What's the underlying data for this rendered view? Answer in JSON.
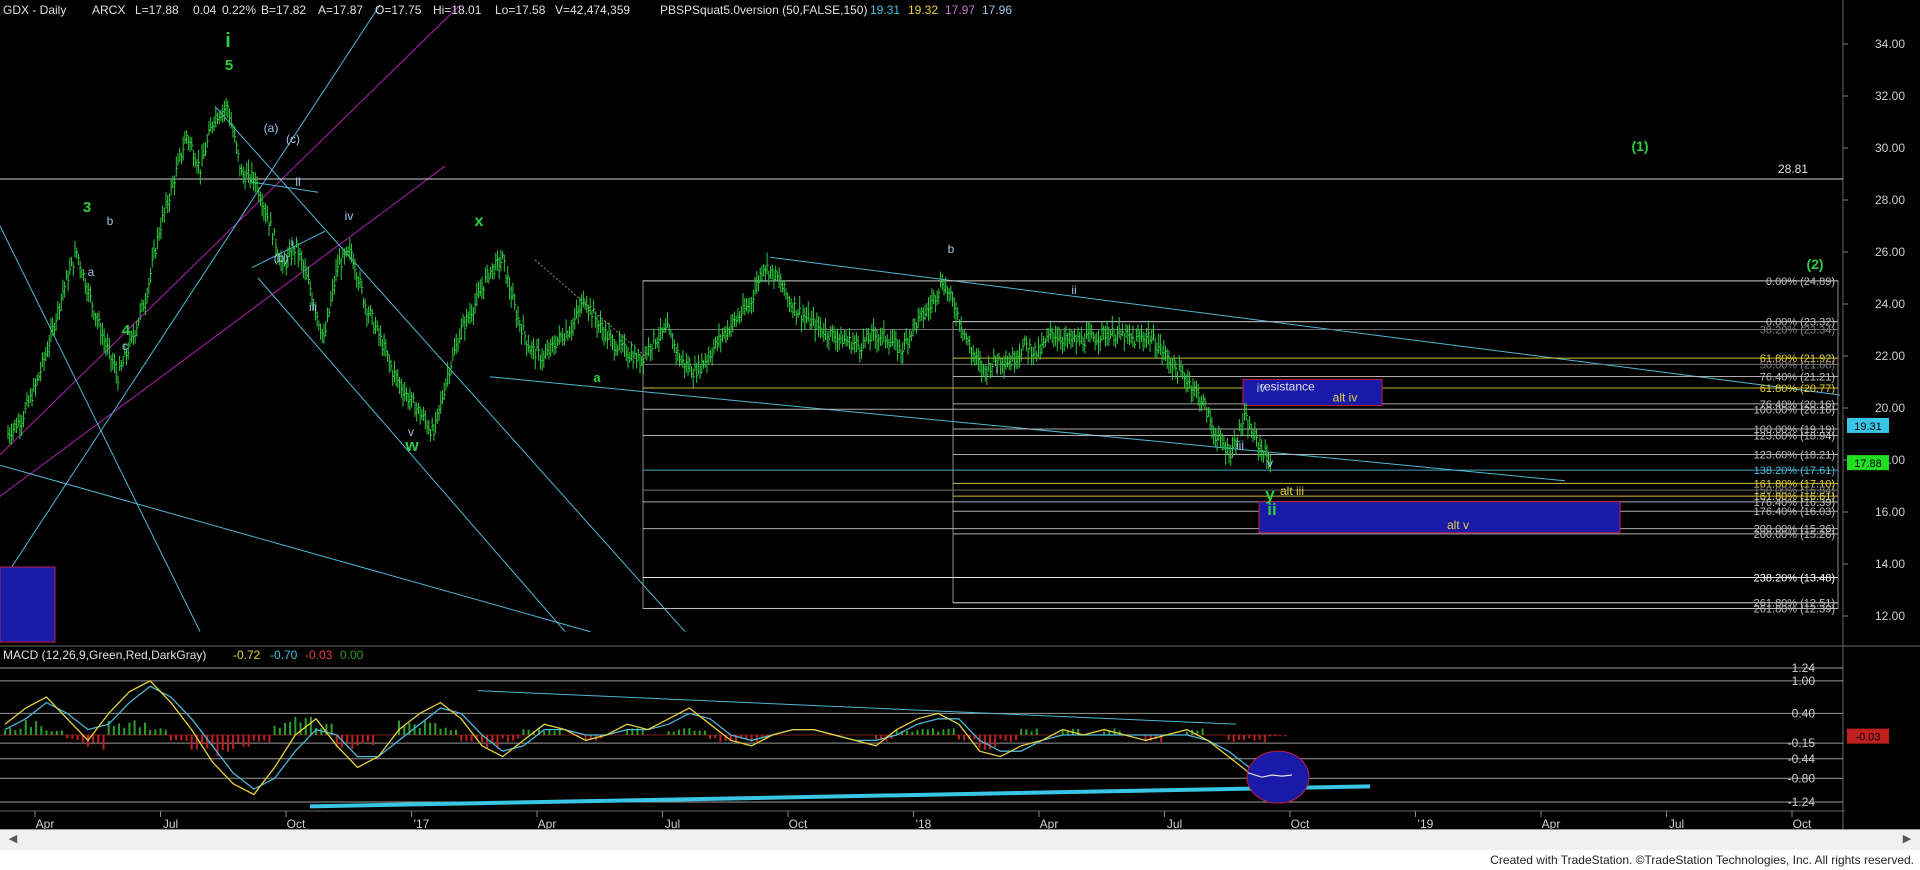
{
  "header": {
    "symbol": "GDX - Daily",
    "exchange": "ARCX",
    "last": "L=17.88",
    "change": "0.04",
    "change_pct": "0.22%",
    "bid": "B=17.82",
    "ask": "A=17.87",
    "open": "O=17.75",
    "high": "Hi=18.01",
    "low": "Lo=17.58",
    "volume": "V=42,474,359",
    "indicator": "PBSPSquat5.0version (50,FALSE,150)",
    "ind_values": [
      "19.31",
      "19.32",
      "17.97",
      "17.96"
    ]
  },
  "colors": {
    "background": "#000000",
    "wave_green": "#2ecc40",
    "wave_blue": "#a0c4e8",
    "channel_blue": "#4fb7d6",
    "channel_magenta": "#b01fb0",
    "resistance_box": "#1a1aa8",
    "fib_yellow": "#e6d23c",
    "macd_green": "#2aa02a",
    "macd_red": "#c02020",
    "price_tag_blue": "#39c5e6",
    "price_tag_green": "#22dd22"
  },
  "chart_data": [
    {
      "type": "line",
      "name": "price",
      "title": "GDX - Daily",
      "ylim": [
        11,
        35
      ],
      "yticks": [
        "34.00",
        "32.00",
        "30.00",
        "28.00",
        "26.00",
        "24.00",
        "22.00",
        "20.00",
        "18.00",
        "16.00",
        "14.00",
        "12.00"
      ],
      "x_tick_labels": [
        "Apr",
        "Jul",
        "Oct",
        "'17",
        "Apr",
        "Jul",
        "Oct",
        "'18",
        "Apr",
        "Jul",
        "Oct",
        "'19",
        "Apr",
        "Jul",
        "Oct"
      ],
      "series": [
        {
          "values": [
            19.0,
            19.6,
            20.8,
            22.5,
            24.5,
            26.0,
            24.2,
            22.6,
            21.2,
            22.6,
            24.2,
            26.8,
            28.6,
            30.5,
            29.2,
            31.2,
            31.6,
            29.0,
            28.8,
            27.2,
            25.4,
            26.2,
            24.6,
            22.6,
            25.5,
            26.0,
            24.0,
            22.8,
            21.4,
            20.5,
            19.8,
            19.0,
            21.3,
            23.0,
            24.0,
            25.2,
            25.7,
            23.6,
            22.3,
            21.9,
            22.6,
            23.1,
            24.2,
            23.2,
            22.5,
            22.2,
            21.8,
            22.6,
            23.0,
            21.8,
            21.4,
            22.0,
            22.8,
            23.4,
            24.0,
            25.5,
            25.0,
            24.0,
            23.5,
            23.1,
            22.8,
            22.6,
            22.4,
            22.8,
            22.7,
            22.2,
            23.2,
            23.8,
            24.9,
            23.8,
            22.3,
            21.4,
            21.9,
            21.8,
            22.4,
            22.1,
            22.9,
            22.6,
            22.6,
            22.7,
            22.9,
            22.8,
            22.6,
            22.8,
            22.2,
            21.5,
            21.0,
            20.2,
            18.8,
            18.3,
            19.6,
            18.6,
            17.88
          ]
        }
      ],
      "wave_labels_green": [
        "i",
        "5",
        "3",
        "4",
        "x",
        "a",
        "w",
        "y",
        "ii",
        "(1)",
        "(2)"
      ],
      "wave_labels_blue": [
        "(a)",
        "(c)",
        "(b)",
        "ii",
        "i",
        "iv",
        "iii",
        "v",
        "b",
        "ii",
        "i",
        "iv",
        "iii",
        "v",
        "a",
        "b",
        "c"
      ],
      "box_labels": {
        "resistance": "resistance",
        "alt_iv": "alt iv",
        "alt_iii": "alt iii",
        "alt_v": "alt v"
      },
      "hline_label": "28.81",
      "fib_levels": [
        {
          "label": "0.00% (24.89)",
          "price": 24.89,
          "color": "#c0c0c0"
        },
        {
          "label": "0.00% (23.32)",
          "price": 23.32,
          "color": "#c0c0c0"
        },
        {
          "label": "38.20% (23.34)",
          "price": 23.02,
          "color": "#7e7e7e"
        },
        {
          "label": "61.80% (21.92)",
          "price": 21.92,
          "color": "#e6d23c"
        },
        {
          "label": "50.00% (21.68)",
          "price": 21.68,
          "color": "#7e7e7e"
        },
        {
          "label": "76.40% (21.21)",
          "price": 21.21,
          "color": "#c0c0c0"
        },
        {
          "label": "61.80% (20.77)",
          "price": 20.77,
          "color": "#e6d23c"
        },
        {
          "label": "76.40% (20.16)",
          "price": 20.16,
          "color": "#c0c0c0"
        },
        {
          "label": "100.00% (20.16)",
          "price": 19.95,
          "color": "#c0c0c0"
        },
        {
          "label": "100.00% (19.19)",
          "price": 19.19,
          "color": "#c0c0c0"
        },
        {
          "label": "123.60% (18.94)",
          "price": 18.94,
          "color": "#c0c0c0"
        },
        {
          "label": "123.60% (18.21)",
          "price": 18.21,
          "color": "#c0c0c0"
        },
        {
          "label": "138.20% (17.61)",
          "price": 17.61,
          "color": "#4fb7d6"
        },
        {
          "label": "161.80% (17.10)",
          "price": 17.1,
          "color": "#e6d23c"
        },
        {
          "label": "150.00% (16.84)",
          "price": 16.84,
          "color": "#7e7e7e"
        },
        {
          "label": "161.80% (16.61)",
          "price": 16.61,
          "color": "#e6d23c"
        },
        {
          "label": "176.40% (16.39)",
          "price": 16.39,
          "color": "#c0c0c0"
        },
        {
          "label": "176.40% (16.03)",
          "price": 16.03,
          "color": "#c0c0c0"
        },
        {
          "label": "200.00% (15.26)",
          "price": 15.36,
          "color": "#c0c0c0"
        },
        {
          "label": "200.00% (15.26)",
          "price": 15.16,
          "color": "#c0c0c0"
        },
        {
          "label": "238.20% (13.48)",
          "price": 13.48,
          "color": "#ffffff"
        },
        {
          "label": "261.80% (12.51)",
          "price": 12.51,
          "color": "#c0c0c0"
        },
        {
          "label": "261.80% (12.39)",
          "price": 12.29,
          "color": "#c0c0c0"
        }
      ],
      "price_tags": [
        {
          "label": "19.31",
          "price": 19.31,
          "color": "#39c5e6"
        },
        {
          "label": "17.88",
          "price": 17.88,
          "color": "#22dd22"
        }
      ]
    },
    {
      "type": "line",
      "name": "MACD",
      "title": "MACD (12,26,9,Green,Red,DarkGray)",
      "params_values": [
        "-0.72",
        "-0.70",
        "-0.03",
        "0.00"
      ],
      "ylim": [
        -1.35,
        1.35
      ],
      "yticks": [
        "1.24",
        "1.00",
        "0.40",
        "-0.15",
        "-0.44",
        "-0.80",
        "-1.24"
      ],
      "last_value_tag": "-0.03",
      "series": [
        {
          "name": "MACD",
          "values": [
            0.2,
            0.5,
            0.7,
            0.3,
            -0.1,
            0.4,
            0.8,
            1.0,
            0.6,
            0.1,
            -0.5,
            -0.9,
            -1.1,
            -0.6,
            0.0,
            0.3,
            -0.2,
            -0.6,
            -0.4,
            0.1,
            0.4,
            0.6,
            0.3,
            -0.2,
            -0.4,
            -0.1,
            0.2,
            0.1,
            -0.1,
            0.0,
            0.2,
            0.1,
            0.3,
            0.5,
            0.2,
            -0.1,
            -0.2,
            0.0,
            0.1,
            0.1,
            0.0,
            -0.1,
            -0.2,
            0.1,
            0.3,
            0.4,
            0.2,
            -0.3,
            -0.4,
            -0.2,
            -0.1,
            0.1,
            0.0,
            0.1,
            0.0,
            -0.1,
            0.0,
            0.1,
            -0.1,
            -0.4,
            -0.7,
            -0.72
          ]
        },
        {
          "name": "Signal",
          "values": [
            0.1,
            0.3,
            0.6,
            0.4,
            0.1,
            0.2,
            0.6,
            0.9,
            0.7,
            0.3,
            -0.2,
            -0.7,
            -1.0,
            -0.8,
            -0.3,
            0.1,
            0.0,
            -0.4,
            -0.4,
            -0.1,
            0.2,
            0.5,
            0.4,
            0.0,
            -0.3,
            -0.2,
            0.1,
            0.1,
            0.0,
            0.0,
            0.1,
            0.1,
            0.2,
            0.4,
            0.3,
            0.0,
            -0.1,
            0.0,
            0.1,
            0.1,
            0.0,
            -0.1,
            -0.1,
            0.0,
            0.2,
            0.3,
            0.3,
            -0.1,
            -0.3,
            -0.3,
            -0.1,
            0.0,
            0.0,
            0.0,
            0.0,
            0.0,
            0.0,
            0.0,
            -0.1,
            -0.3,
            -0.6,
            -0.7
          ]
        }
      ]
    }
  ],
  "footer": {
    "credit": "Created with TradeStation. ©TradeStation Technologies, Inc. All rights reserved."
  }
}
